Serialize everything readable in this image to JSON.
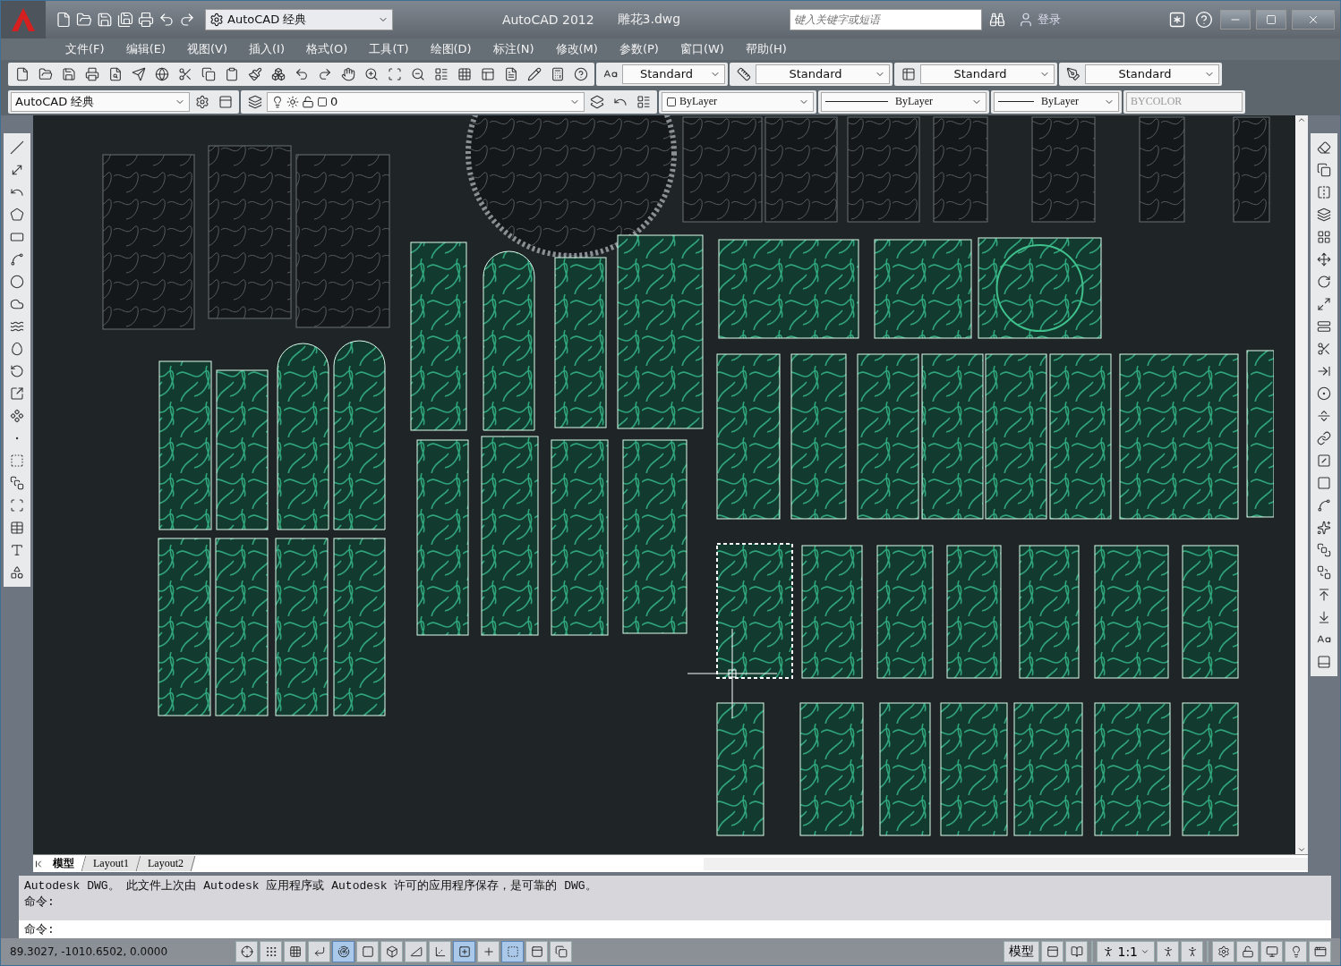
{
  "title_bar": {
    "workspace": "AutoCAD 经典",
    "app_title": "AutoCAD 2012",
    "file_name": "雕花3.dwg",
    "search": {
      "placeholder": "键入关键字或短语"
    },
    "sign_in": "登录"
  },
  "menu": [
    "文件(F)",
    "编辑(E)",
    "视图(V)",
    "插入(I)",
    "格式(O)",
    "工具(T)",
    "绘图(D)",
    "标注(N)",
    "修改(M)",
    "参数(P)",
    "窗口(W)",
    "帮助(H)"
  ],
  "style_dropdowns": [
    "Standard",
    "Standard",
    "Standard",
    "Standard"
  ],
  "properties_bar": {
    "workspace": "AutoCAD 经典",
    "layer": "0",
    "color_setting": "ByLayer",
    "linetype": "ByLayer",
    "lineweight": "ByLayer",
    "plot_style": {
      "value": "BYCOLOR",
      "disabled": true
    }
  },
  "layout_tabs": [
    {
      "label": "模型",
      "selected": true
    },
    {
      "label": "Layout1",
      "selected": false
    },
    {
      "label": "Layout2",
      "selected": false
    }
  ],
  "command_history": [
    "Autodesk DWG。 此文件上次由 Autodesk 应用程序或 Autodesk 许可的应用程序保存，是可靠的 DWG。",
    "命令:"
  ],
  "command_prompt": "命令:",
  "status_bar": {
    "coordinates": "89.3027,  -1010.6502, 0.0000",
    "toggles": [
      {
        "on": false
      },
      {
        "on": false
      },
      {
        "on": false
      },
      {
        "on": false
      },
      {
        "on": true
      },
      {
        "on": false
      },
      {
        "on": false
      },
      {
        "on": false
      },
      {
        "on": false
      },
      {
        "on": true
      },
      {
        "on": false
      },
      {
        "on": true
      },
      {
        "on": false
      },
      {
        "on": false
      }
    ],
    "space": "模型",
    "scale": "1:1"
  }
}
